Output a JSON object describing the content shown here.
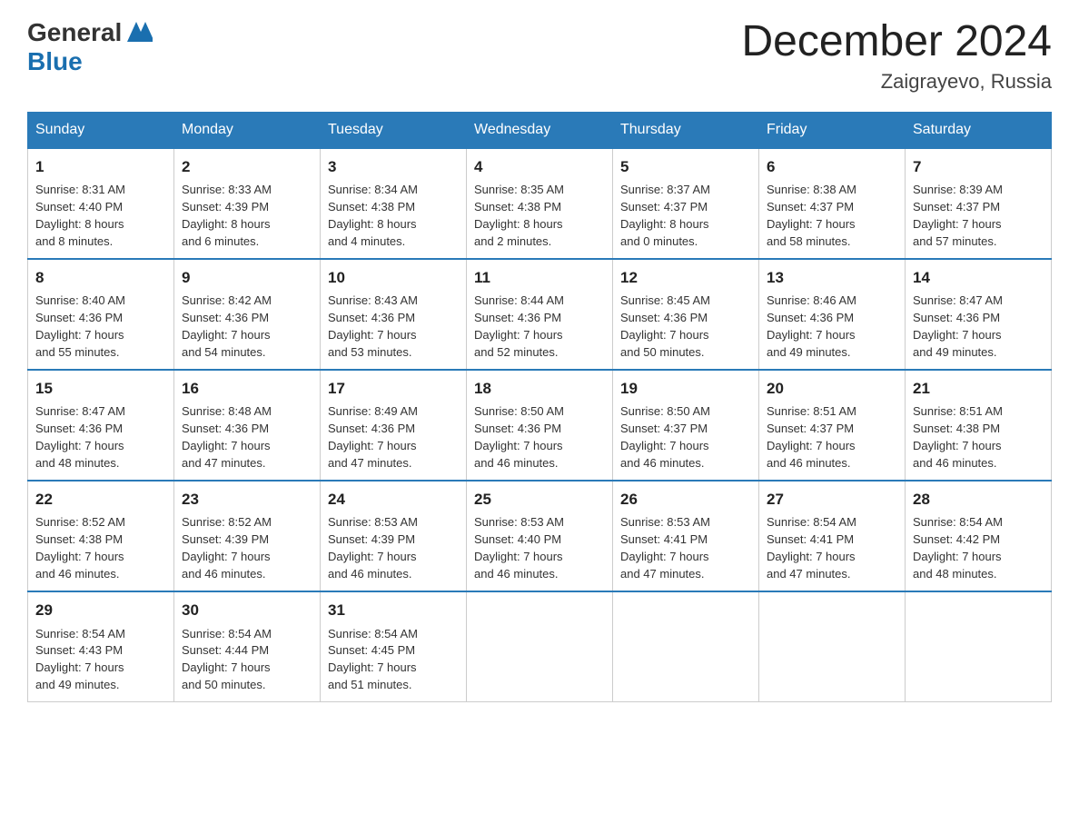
{
  "header": {
    "logo_general": "General",
    "logo_blue": "Blue",
    "month_title": "December 2024",
    "location": "Zaigrayevo, Russia"
  },
  "days_of_week": [
    "Sunday",
    "Monday",
    "Tuesday",
    "Wednesday",
    "Thursday",
    "Friday",
    "Saturday"
  ],
  "weeks": [
    [
      {
        "day": "1",
        "info": "Sunrise: 8:31 AM\nSunset: 4:40 PM\nDaylight: 8 hours\nand 8 minutes."
      },
      {
        "day": "2",
        "info": "Sunrise: 8:33 AM\nSunset: 4:39 PM\nDaylight: 8 hours\nand 6 minutes."
      },
      {
        "day": "3",
        "info": "Sunrise: 8:34 AM\nSunset: 4:38 PM\nDaylight: 8 hours\nand 4 minutes."
      },
      {
        "day": "4",
        "info": "Sunrise: 8:35 AM\nSunset: 4:38 PM\nDaylight: 8 hours\nand 2 minutes."
      },
      {
        "day": "5",
        "info": "Sunrise: 8:37 AM\nSunset: 4:37 PM\nDaylight: 8 hours\nand 0 minutes."
      },
      {
        "day": "6",
        "info": "Sunrise: 8:38 AM\nSunset: 4:37 PM\nDaylight: 7 hours\nand 58 minutes."
      },
      {
        "day": "7",
        "info": "Sunrise: 8:39 AM\nSunset: 4:37 PM\nDaylight: 7 hours\nand 57 minutes."
      }
    ],
    [
      {
        "day": "8",
        "info": "Sunrise: 8:40 AM\nSunset: 4:36 PM\nDaylight: 7 hours\nand 55 minutes."
      },
      {
        "day": "9",
        "info": "Sunrise: 8:42 AM\nSunset: 4:36 PM\nDaylight: 7 hours\nand 54 minutes."
      },
      {
        "day": "10",
        "info": "Sunrise: 8:43 AM\nSunset: 4:36 PM\nDaylight: 7 hours\nand 53 minutes."
      },
      {
        "day": "11",
        "info": "Sunrise: 8:44 AM\nSunset: 4:36 PM\nDaylight: 7 hours\nand 52 minutes."
      },
      {
        "day": "12",
        "info": "Sunrise: 8:45 AM\nSunset: 4:36 PM\nDaylight: 7 hours\nand 50 minutes."
      },
      {
        "day": "13",
        "info": "Sunrise: 8:46 AM\nSunset: 4:36 PM\nDaylight: 7 hours\nand 49 minutes."
      },
      {
        "day": "14",
        "info": "Sunrise: 8:47 AM\nSunset: 4:36 PM\nDaylight: 7 hours\nand 49 minutes."
      }
    ],
    [
      {
        "day": "15",
        "info": "Sunrise: 8:47 AM\nSunset: 4:36 PM\nDaylight: 7 hours\nand 48 minutes."
      },
      {
        "day": "16",
        "info": "Sunrise: 8:48 AM\nSunset: 4:36 PM\nDaylight: 7 hours\nand 47 minutes."
      },
      {
        "day": "17",
        "info": "Sunrise: 8:49 AM\nSunset: 4:36 PM\nDaylight: 7 hours\nand 47 minutes."
      },
      {
        "day": "18",
        "info": "Sunrise: 8:50 AM\nSunset: 4:36 PM\nDaylight: 7 hours\nand 46 minutes."
      },
      {
        "day": "19",
        "info": "Sunrise: 8:50 AM\nSunset: 4:37 PM\nDaylight: 7 hours\nand 46 minutes."
      },
      {
        "day": "20",
        "info": "Sunrise: 8:51 AM\nSunset: 4:37 PM\nDaylight: 7 hours\nand 46 minutes."
      },
      {
        "day": "21",
        "info": "Sunrise: 8:51 AM\nSunset: 4:38 PM\nDaylight: 7 hours\nand 46 minutes."
      }
    ],
    [
      {
        "day": "22",
        "info": "Sunrise: 8:52 AM\nSunset: 4:38 PM\nDaylight: 7 hours\nand 46 minutes."
      },
      {
        "day": "23",
        "info": "Sunrise: 8:52 AM\nSunset: 4:39 PM\nDaylight: 7 hours\nand 46 minutes."
      },
      {
        "day": "24",
        "info": "Sunrise: 8:53 AM\nSunset: 4:39 PM\nDaylight: 7 hours\nand 46 minutes."
      },
      {
        "day": "25",
        "info": "Sunrise: 8:53 AM\nSunset: 4:40 PM\nDaylight: 7 hours\nand 46 minutes."
      },
      {
        "day": "26",
        "info": "Sunrise: 8:53 AM\nSunset: 4:41 PM\nDaylight: 7 hours\nand 47 minutes."
      },
      {
        "day": "27",
        "info": "Sunrise: 8:54 AM\nSunset: 4:41 PM\nDaylight: 7 hours\nand 47 minutes."
      },
      {
        "day": "28",
        "info": "Sunrise: 8:54 AM\nSunset: 4:42 PM\nDaylight: 7 hours\nand 48 minutes."
      }
    ],
    [
      {
        "day": "29",
        "info": "Sunrise: 8:54 AM\nSunset: 4:43 PM\nDaylight: 7 hours\nand 49 minutes."
      },
      {
        "day": "30",
        "info": "Sunrise: 8:54 AM\nSunset: 4:44 PM\nDaylight: 7 hours\nand 50 minutes."
      },
      {
        "day": "31",
        "info": "Sunrise: 8:54 AM\nSunset: 4:45 PM\nDaylight: 7 hours\nand 51 minutes."
      },
      null,
      null,
      null,
      null
    ]
  ]
}
